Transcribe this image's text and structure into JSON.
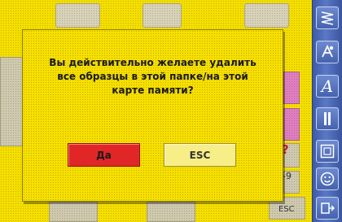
{
  "dialog": {
    "message_line1": "Вы действительно желаете удалить",
    "message_line2": "все образцы в этой папке/на этой",
    "message_line3": "карте памяти?",
    "confirm_label": "Да",
    "cancel_label": "ESC"
  },
  "background": {
    "corner_label": "ESC",
    "partial_label": "-9",
    "question_mark": "?"
  },
  "toolbar": {
    "items": [
      "stitch-icon",
      "embroidery-icon",
      "text-icon",
      "buttonhole-icon",
      "pattern-icon",
      "smiley-icon",
      "memory-icon"
    ],
    "letter_a": "A"
  },
  "colors": {
    "screen_bg": "#f5df00",
    "toolbar_bg": "#4d69b8",
    "confirm_bg": "#e02626",
    "cancel_bg": "#f7ee88"
  }
}
